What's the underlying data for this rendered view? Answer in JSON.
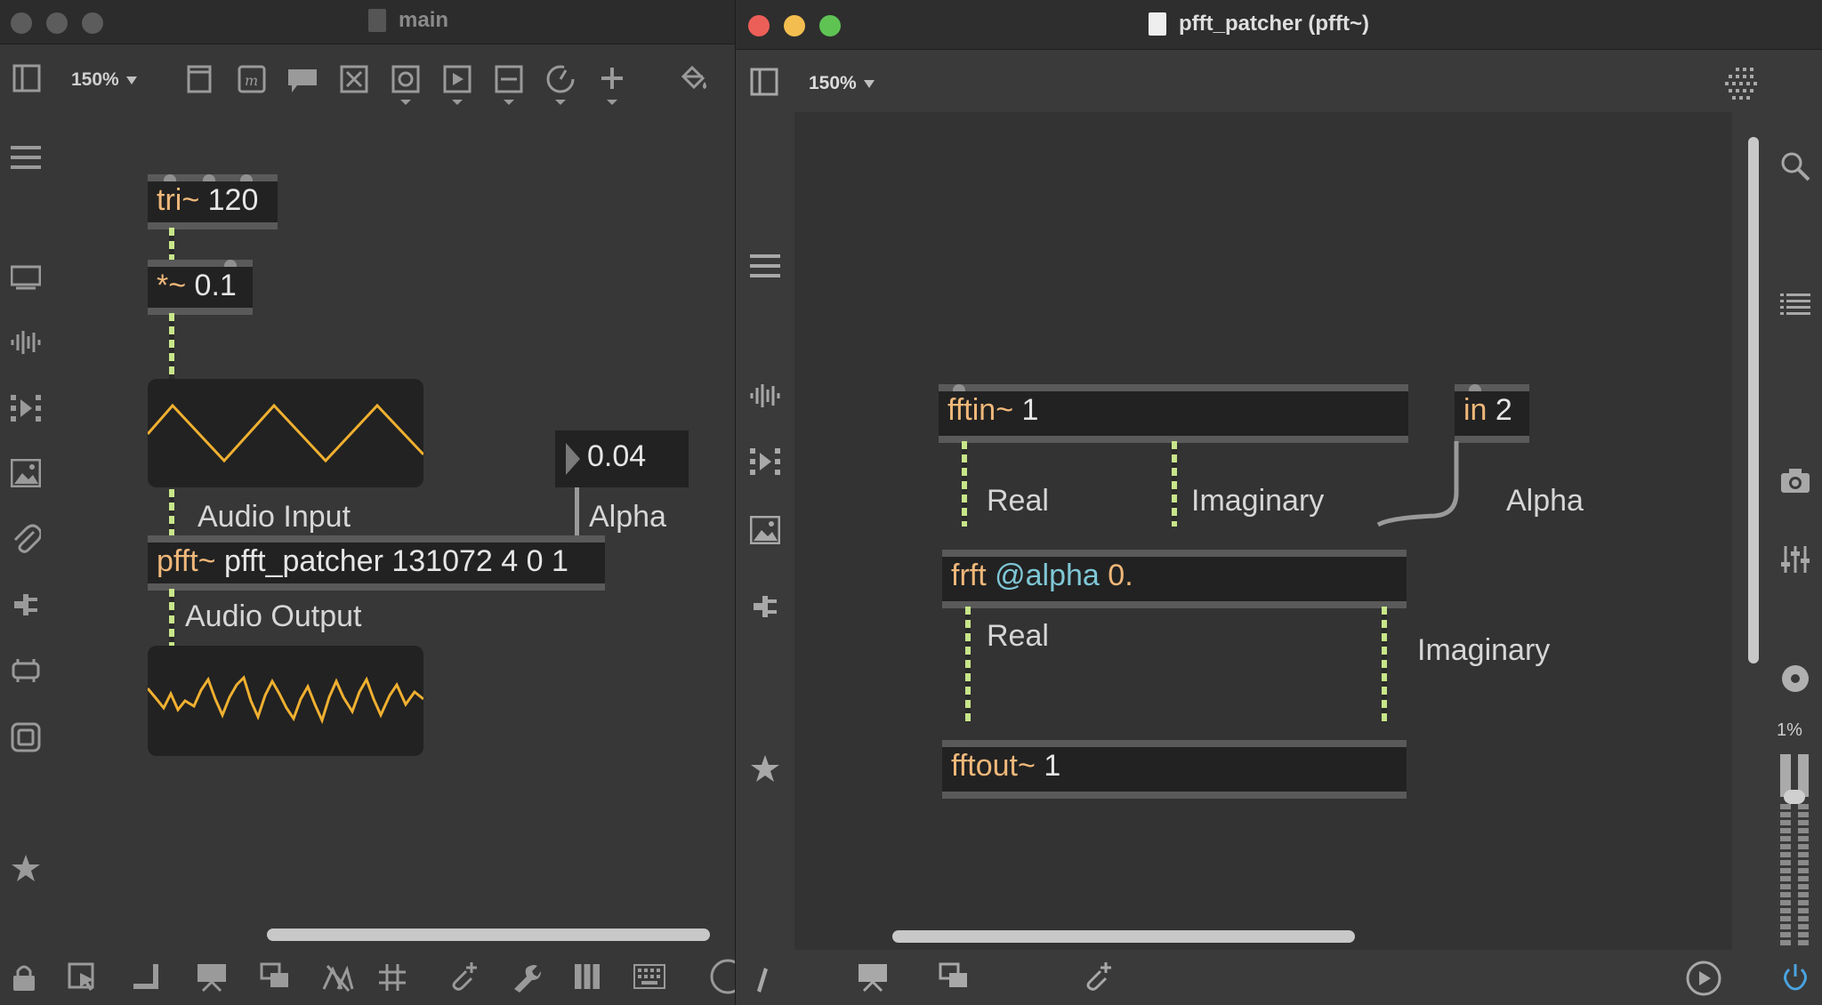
{
  "main_window": {
    "title": "main",
    "zoom": "150%",
    "objects": {
      "tri": {
        "name": "tri~",
        "args": "120"
      },
      "mul": {
        "name": "*~",
        "args": "0.1"
      },
      "number": "0.04",
      "pfft": {
        "name": "pfft~",
        "args": "pfft_patcher 131072 4 0 1"
      }
    },
    "comments": {
      "audio_input": "Audio Input",
      "alpha": "Alpha",
      "audio_output": "Audio Output"
    }
  },
  "pfft_window": {
    "title": "pfft_patcher (pfft~)",
    "zoom": "150%",
    "objects": {
      "fftin": {
        "name": "fftin~",
        "args": "1"
      },
      "in2": {
        "name": "in",
        "args": "2"
      },
      "frft": {
        "name": "frft",
        "attr": "@alpha",
        "value": "0."
      },
      "fftout": {
        "name": "fftout~",
        "args": "1"
      }
    },
    "comments": {
      "real_top": "Real",
      "imag_top": "Imaginary",
      "alpha": "Alpha",
      "real_bottom": "Real",
      "imag_bottom": "Imaginary"
    },
    "cpu": "1%"
  },
  "colors": {
    "signal_cord": "#c8e68a",
    "object_name": "#f0b87a",
    "attribute": "#7fc7d6",
    "scope_trace": "#f0b030",
    "close": "#ec5f58",
    "minimize": "#f3be4f",
    "maximize": "#5fc354",
    "power": "#4aa3e0"
  }
}
